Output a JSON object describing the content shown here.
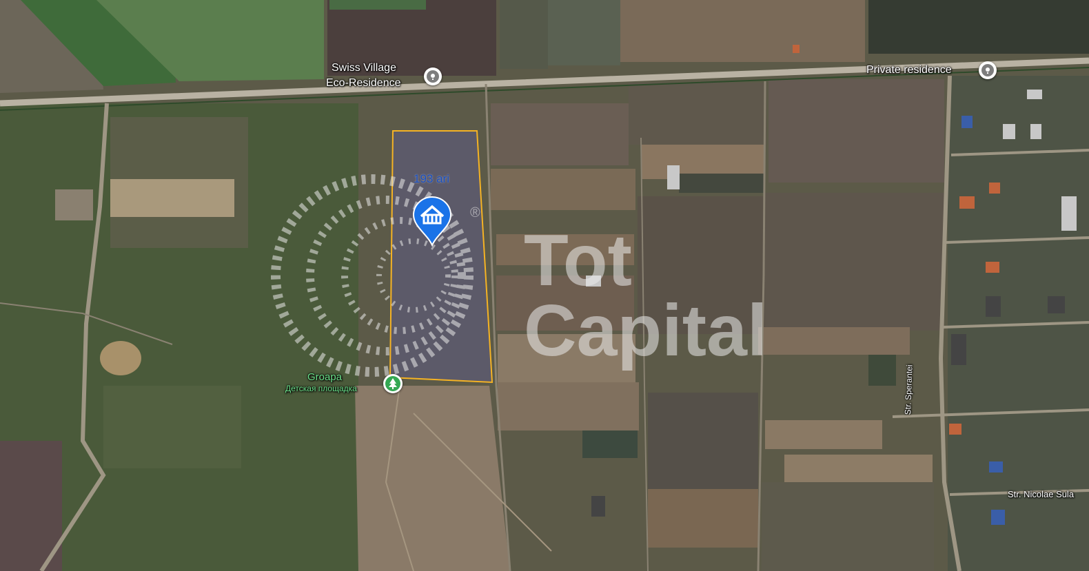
{
  "map": {
    "plot_area_label": "193 ari",
    "watermark": {
      "line1": "Tot",
      "line2": "Capital",
      "registered": "®"
    },
    "pois": [
      {
        "line1": "Swiss Village",
        "line2": "Eco-Residence",
        "icon": "pin-icon"
      },
      {
        "line1": "Private residence",
        "icon": "pin-icon"
      },
      {
        "line1": "Groapa",
        "line2": "Детская площадка",
        "icon": "tree-icon"
      }
    ],
    "streets": {
      "sperantei": "Str. Sperantei",
      "nicolae": "Str. Nicolae Sula"
    },
    "colors": {
      "plot_outline": "#f5b324",
      "property_marker": "#1a73e8",
      "park_marker": "#34a853",
      "plot_label": "#1a4fbf"
    }
  }
}
